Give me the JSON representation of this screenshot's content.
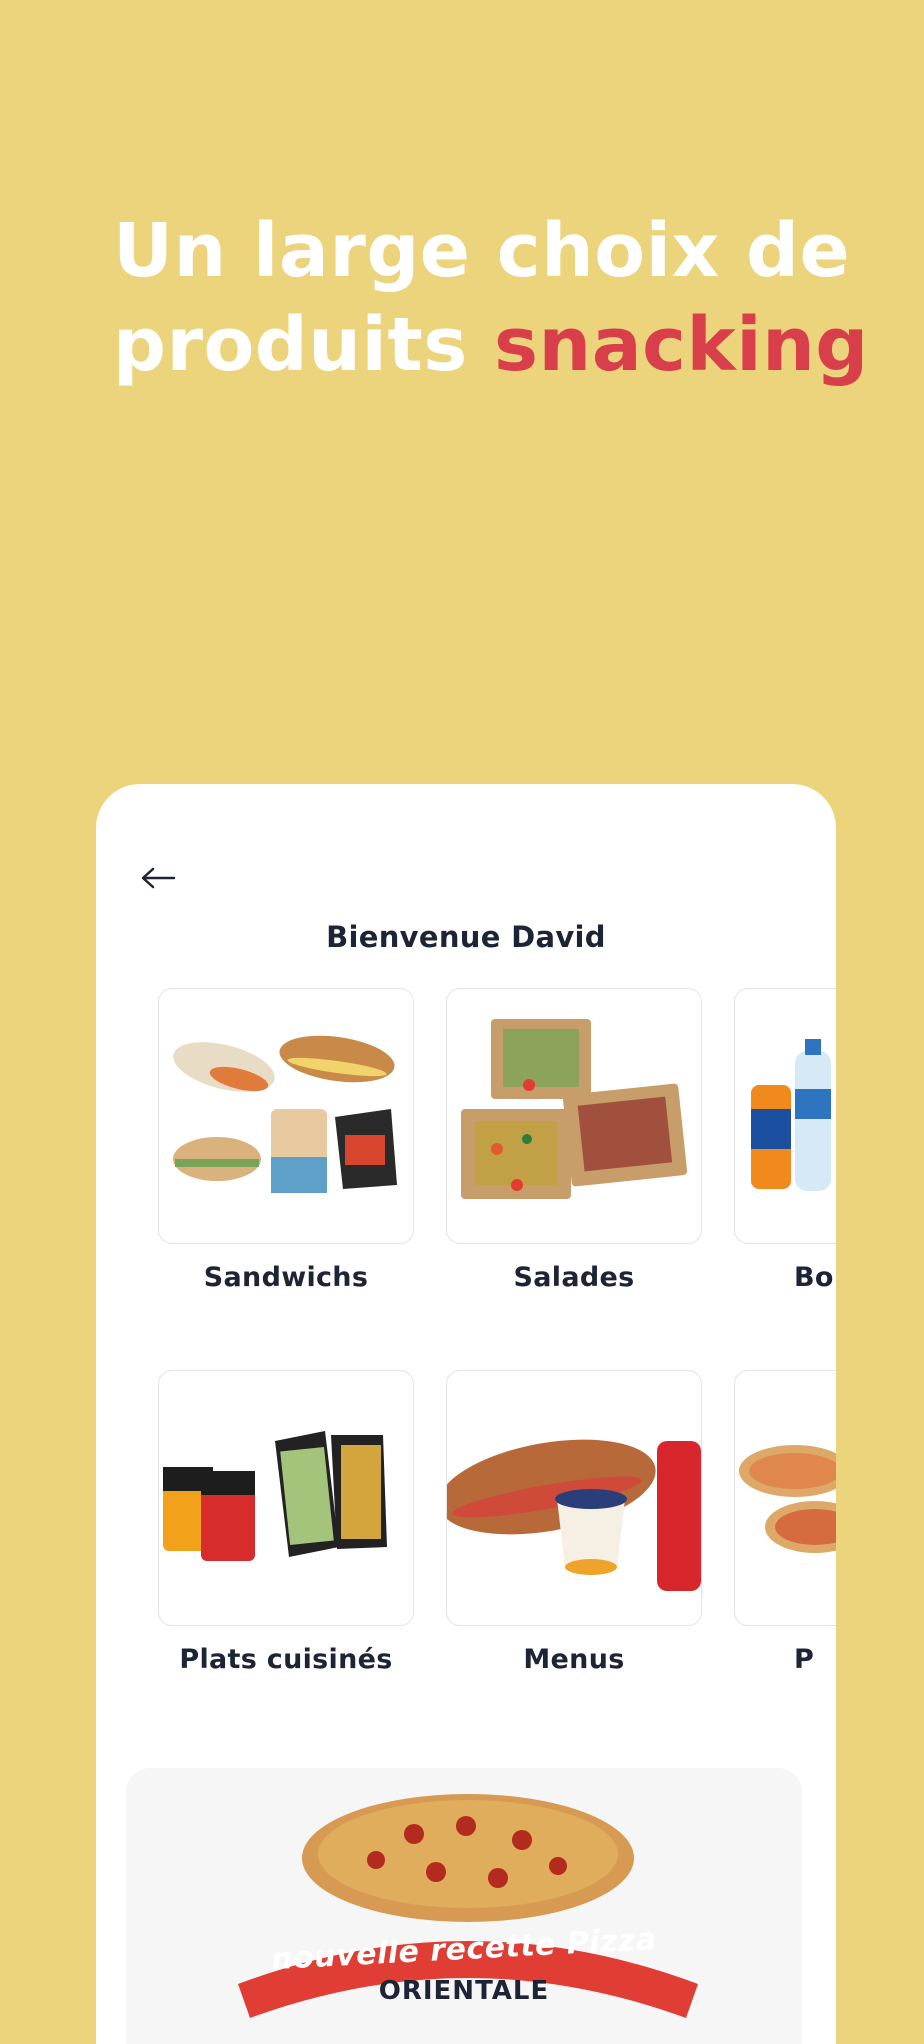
{
  "headline": {
    "line1": "Un large choix de",
    "line2_plain": "produits",
    "line2_accent": "snacking"
  },
  "header": {
    "back_icon": "arrow-left-icon",
    "welcome": "Bienvenue David"
  },
  "categories": [
    {
      "label": "Sandwichs"
    },
    {
      "label": "Salades"
    },
    {
      "label": "Bo"
    },
    {
      "label": "Plats cuisinés"
    },
    {
      "label": "Menus"
    },
    {
      "label": "P"
    }
  ],
  "promo": {
    "title": "nouvelle recette Pizza",
    "subtitle": "ORIENTALE"
  },
  "colors": {
    "background": "#ecd47d",
    "accent": "#d93f4a",
    "text": "#1d2435"
  }
}
